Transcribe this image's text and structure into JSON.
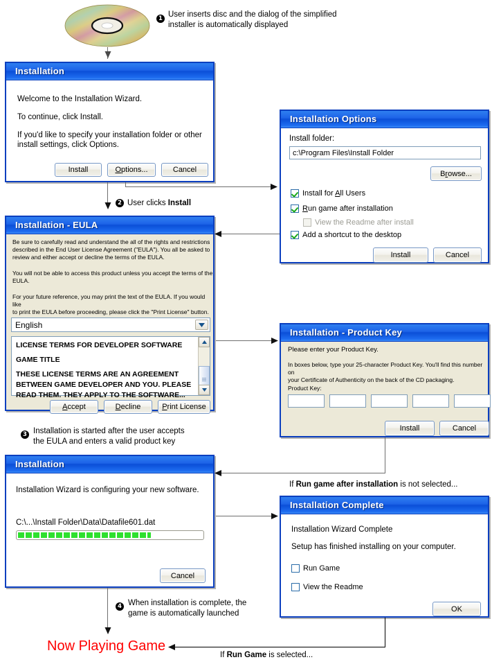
{
  "diagram": {
    "title": "Simplified installer flow",
    "final_state": "Now Playing Game",
    "annotations": [
      {
        "num": "❶",
        "lines": [
          "User inserts disc and the dialog of the simplified",
          "installer is automatically displayed"
        ]
      },
      {
        "num": "❷",
        "prefix": "User clicks ",
        "bold": "Install"
      },
      {
        "num": "❸",
        "lines": [
          "Installation is started after the user accepts",
          "the EULA and enters a valid product key"
        ]
      },
      {
        "num": "❹",
        "lines": [
          "When installation is complete, the",
          "game is automatically launched"
        ]
      }
    ],
    "edge_labels": [
      {
        "prefix": "If ",
        "bold": "Run game after installation",
        "suffix": " is not selected..."
      },
      {
        "prefix": "If ",
        "bold": "Run Game",
        "suffix": " is selected..."
      }
    ]
  },
  "welcome_dialog": {
    "title": "Installation",
    "line1": "Welcome to the Installation Wizard.",
    "line2": "To continue, click Install.",
    "line3a": "If you'd like to specify your installation folder or other",
    "line3b": "install settings, click Options.",
    "buttons": {
      "install": "Install",
      "options": "Options...",
      "cancel": "Cancel"
    }
  },
  "options_dialog": {
    "title": "Installation Options",
    "folder_label": "Install folder:",
    "folder_value": "c:\\Program Files\\Install Folder",
    "browse_button": "Browse...",
    "checkboxes": [
      {
        "label_pre": "Install for ",
        "label_accel": "A",
        "label_post": "ll Users",
        "checked": true,
        "disabled": false
      },
      {
        "label_pre": "",
        "label_accel": "R",
        "label_post": "un game after installation",
        "checked": true,
        "disabled": false
      },
      {
        "label_pre": "View the Readme after install",
        "label_accel": "",
        "label_post": "",
        "checked": false,
        "disabled": true
      },
      {
        "label_pre": "Add a shortcut to the desktop",
        "label_accel": "",
        "label_post": "",
        "checked": true,
        "disabled": false
      }
    ],
    "buttons": {
      "install": "Install",
      "cancel": "Cancel"
    }
  },
  "eula_dialog": {
    "title": "Installation - EULA",
    "para1": [
      "Be sure to carefully read and understand the all of the rights and restrictions",
      "described in the End User License Agreement (\"EULA\"). You all be asked to",
      "review and either accept or decline the terms of the EULA."
    ],
    "para2": [
      "You will not be able to access this product unless you accept the terms of the",
      "EULA."
    ],
    "para3": [
      "For your future reference, you may print the text of the EULA.  If you would like",
      "to print the EULA before proceeding, please click the \"Print License\" button."
    ],
    "language_value": "English",
    "license_text": [
      "LICENSE TERMS FOR DEVELOPER SOFTWARE",
      "",
      "GAME TITLE",
      "",
      "THESE LICENSE TERMS ARE AN AGREEMENT",
      "BETWEEN GAME DEVELOPER AND YOU.  PLEASE",
      "READ THEM.  THEY APPLY TO THE SOFTWARE..."
    ],
    "buttons": {
      "accept_accel": "A",
      "accept_rest": "ccept",
      "decline_accel": "D",
      "decline_rest": "ecline",
      "print_accel": "P",
      "print_rest": "rint License"
    }
  },
  "productkey_dialog": {
    "title": "Installation - Product Key",
    "line1": "Please enter your Product Key.",
    "para": [
      "In boxes below, type your 25-character Product Key.  You'll find this number on",
      "your Certificate of Authenticity on the back of the CD packaging."
    ],
    "key_label": "Product Key:",
    "key_boxes": [
      "",
      "",
      "",
      "",
      ""
    ],
    "buttons": {
      "install": "Install",
      "cancel": "Cancel"
    }
  },
  "progress_dialog": {
    "title": "Installation",
    "line1": "Installation Wizard is configuring your new software.",
    "current_file": "C:\\...\\Install Folder\\Data\\Datafile601.dat",
    "progress_percent": 72,
    "buttons": {
      "cancel": "Cancel"
    }
  },
  "complete_dialog": {
    "title": "Installation Complete",
    "line1": "Installation Wizard Complete",
    "line2": "Setup has finished installing on your computer.",
    "checkboxes": [
      {
        "label": "Run Game",
        "checked": false
      },
      {
        "label": "View the Readme",
        "checked": false
      }
    ],
    "buttons": {
      "ok": "OK"
    }
  },
  "icons": {
    "disc": "cd-disc-icon",
    "dropdown": "chevron-down-icon",
    "scroll_up": "chevron-up-icon",
    "scroll_down": "chevron-down-icon"
  },
  "colors": {
    "titlebar": "#1d63e8",
    "dialog_border": "#0b3fbf",
    "dialog_beige": "#ece9d8",
    "progress_green": "#2ee02e",
    "accent_red": "#ff0000",
    "connector": "#6e6e6e"
  }
}
